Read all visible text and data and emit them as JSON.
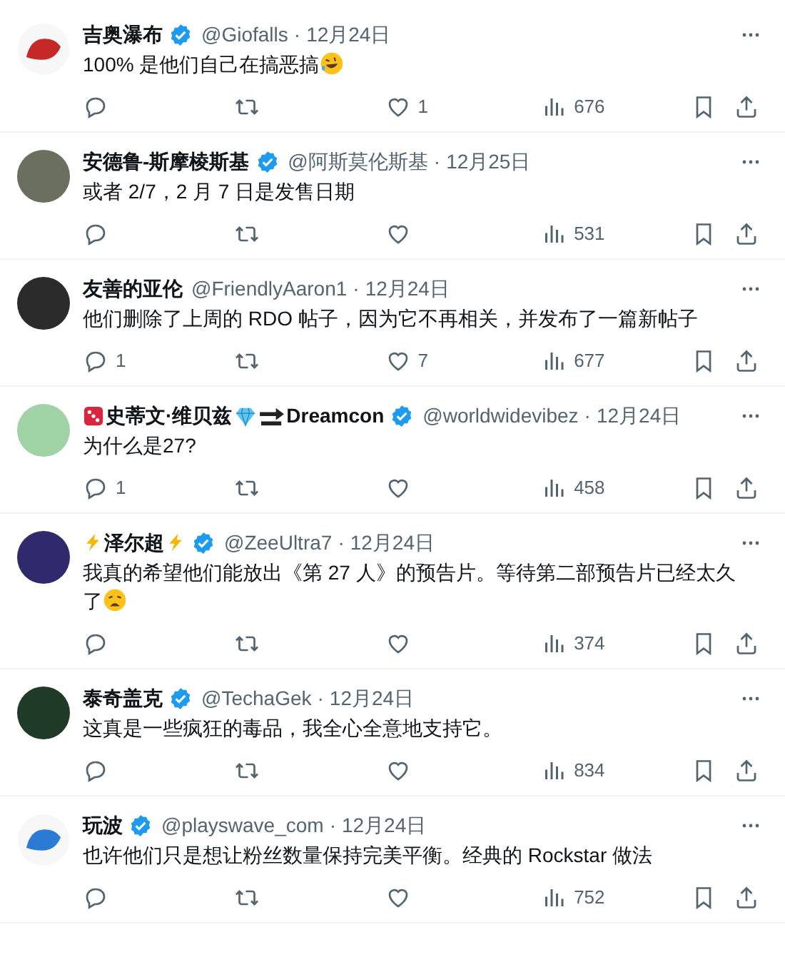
{
  "tweets": [
    {
      "avatar": {
        "kind": "logo",
        "color": "#c62828"
      },
      "name": [
        {
          "kind": "text",
          "text": "吉奥瀑布"
        }
      ],
      "verified": true,
      "handle": "@Giofalls",
      "separator": "·",
      "date": "12月24日",
      "body": [
        {
          "kind": "text",
          "text": "100% 是他们自己在搞恶搞"
        },
        {
          "kind": "laughing"
        }
      ],
      "likes": "1",
      "views": "676"
    },
    {
      "avatar": {
        "kind": "photo",
        "color": "#6b6f5e"
      },
      "name": [
        {
          "kind": "text",
          "text": "安德鲁-斯摩棱斯基"
        }
      ],
      "verified": true,
      "handle": "@阿斯莫伦斯基",
      "separator": "·",
      "date": "12月25日",
      "body": [
        {
          "kind": "text",
          "text": "或者 2/7，2 月 7 日是发售日期"
        }
      ],
      "views": "531"
    },
    {
      "avatar": {
        "kind": "photo",
        "color": "#2b2b2b"
      },
      "name": [
        {
          "kind": "text",
          "text": "友善的亚伦"
        }
      ],
      "verified": false,
      "handle": "@FriendlyAaron1",
      "separator": "·",
      "date": "12月24日",
      "body": [
        {
          "kind": "text",
          "text": "他们删除了上周的 RDO 帖子，因为它不再相关，并发布了一篇新帖子"
        }
      ],
      "replies": "1",
      "likes": "7",
      "views": "677"
    },
    {
      "avatar": {
        "kind": "photo",
        "color": "#9fd3a6"
      },
      "name": [
        {
          "kind": "dice"
        },
        {
          "kind": "text",
          "text": "史蒂文·维贝兹"
        },
        {
          "kind": "gem"
        },
        {
          "kind": "soon"
        },
        {
          "kind": "text",
          "text": "Dreamcon"
        }
      ],
      "verified": true,
      "handle": "@worldwidevibez",
      "separator": "·",
      "date": "12月24日",
      "body": [
        {
          "kind": "text",
          "text": "为什么是27?"
        }
      ],
      "replies": "1",
      "views": "458"
    },
    {
      "avatar": {
        "kind": "photo",
        "color": "#2e2a6b"
      },
      "name": [
        {
          "kind": "bolt"
        },
        {
          "kind": "text",
          "text": "泽尔超"
        },
        {
          "kind": "bolt"
        }
      ],
      "verified": true,
      "handle": "@ZeeUltra7",
      "separator": "·",
      "date": "12月24日",
      "body": [
        {
          "kind": "text",
          "text": "我真的希望他们能放出《第 27 人》的预告片。等待第二部预告片已经太久了"
        },
        {
          "kind": "weary"
        }
      ],
      "views": "374"
    },
    {
      "avatar": {
        "kind": "photo",
        "color": "#1f3a26"
      },
      "name": [
        {
          "kind": "text",
          "text": "泰奇盖克"
        }
      ],
      "verified": true,
      "handle": "@TechaGek",
      "separator": "·",
      "date": "12月24日",
      "body": [
        {
          "kind": "text",
          "text": "这真是一些疯狂的毒品，我全心全意地支持它。"
        }
      ],
      "views": "834"
    },
    {
      "avatar": {
        "kind": "logo",
        "color": "#2b7bd6"
      },
      "name": [
        {
          "kind": "text",
          "text": "玩波"
        }
      ],
      "verified": true,
      "handle": "@playswave_com",
      "separator": "·",
      "date": "12月24日",
      "body": [
        {
          "kind": "text",
          "text": "也许他们只是想让粉丝数量保持完美平衡。经典的 Rockstar 做法"
        }
      ],
      "views": "752"
    }
  ]
}
